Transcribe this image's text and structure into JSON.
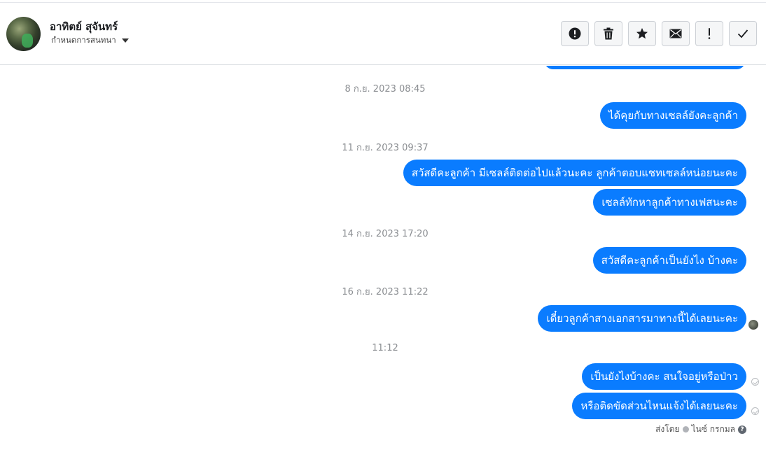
{
  "header": {
    "contact_name": "อาทิตย์ สุจันทร์",
    "assign_label": "กำหนดการสนทนา",
    "actions": [
      {
        "name": "spam-button",
        "icon": "alert-circle-icon"
      },
      {
        "name": "delete-button",
        "icon": "trash-icon"
      },
      {
        "name": "star-button",
        "icon": "star-icon"
      },
      {
        "name": "mark-unread-button",
        "icon": "envelope-icon"
      },
      {
        "name": "follow-up-button",
        "icon": "exclamation-icon"
      },
      {
        "name": "done-button",
        "icon": "check-icon"
      }
    ]
  },
  "thread": {
    "timestamps": [
      "8 ก.ย. 2023 08:45",
      "11 ก.ย. 2023 09:37",
      "14 ก.ย. 2023 17:20",
      "16 ก.ย. 2023 11:22",
      "11:12"
    ],
    "messages": [
      "ได้คุยกับทางเซลล์ยังคะลูกค้า",
      "สวัสดีคะลูกค้า มีเซลล์ติดต่อไปแล้วนะคะ ลูกค้าตอบแชทเซลล์หน่อยนะคะ",
      "เซลล์ทักหาลูกค้าทางเฟสนะคะ",
      "สวัสดีคะลูกค้าเป็นยังไง บ้างคะ",
      "เดี๋ยวลูกค้าสางเอกสารมาทางนี้ได้เลยนะคะ",
      "เป็นยังไงบ้างคะ สนใจอยู่หรือป่าว",
      "หรือติดขัดส่วนไหนแจ้งได้เลยนะคะ"
    ],
    "sent_by_label": "ส่งโดย",
    "sent_by_name": "ไนซ์ กรกมล",
    "help_glyph": "?"
  },
  "colors": {
    "bubble": "#0a7cff",
    "timestamp": "#8a8d91",
    "border": "#dadde1"
  }
}
